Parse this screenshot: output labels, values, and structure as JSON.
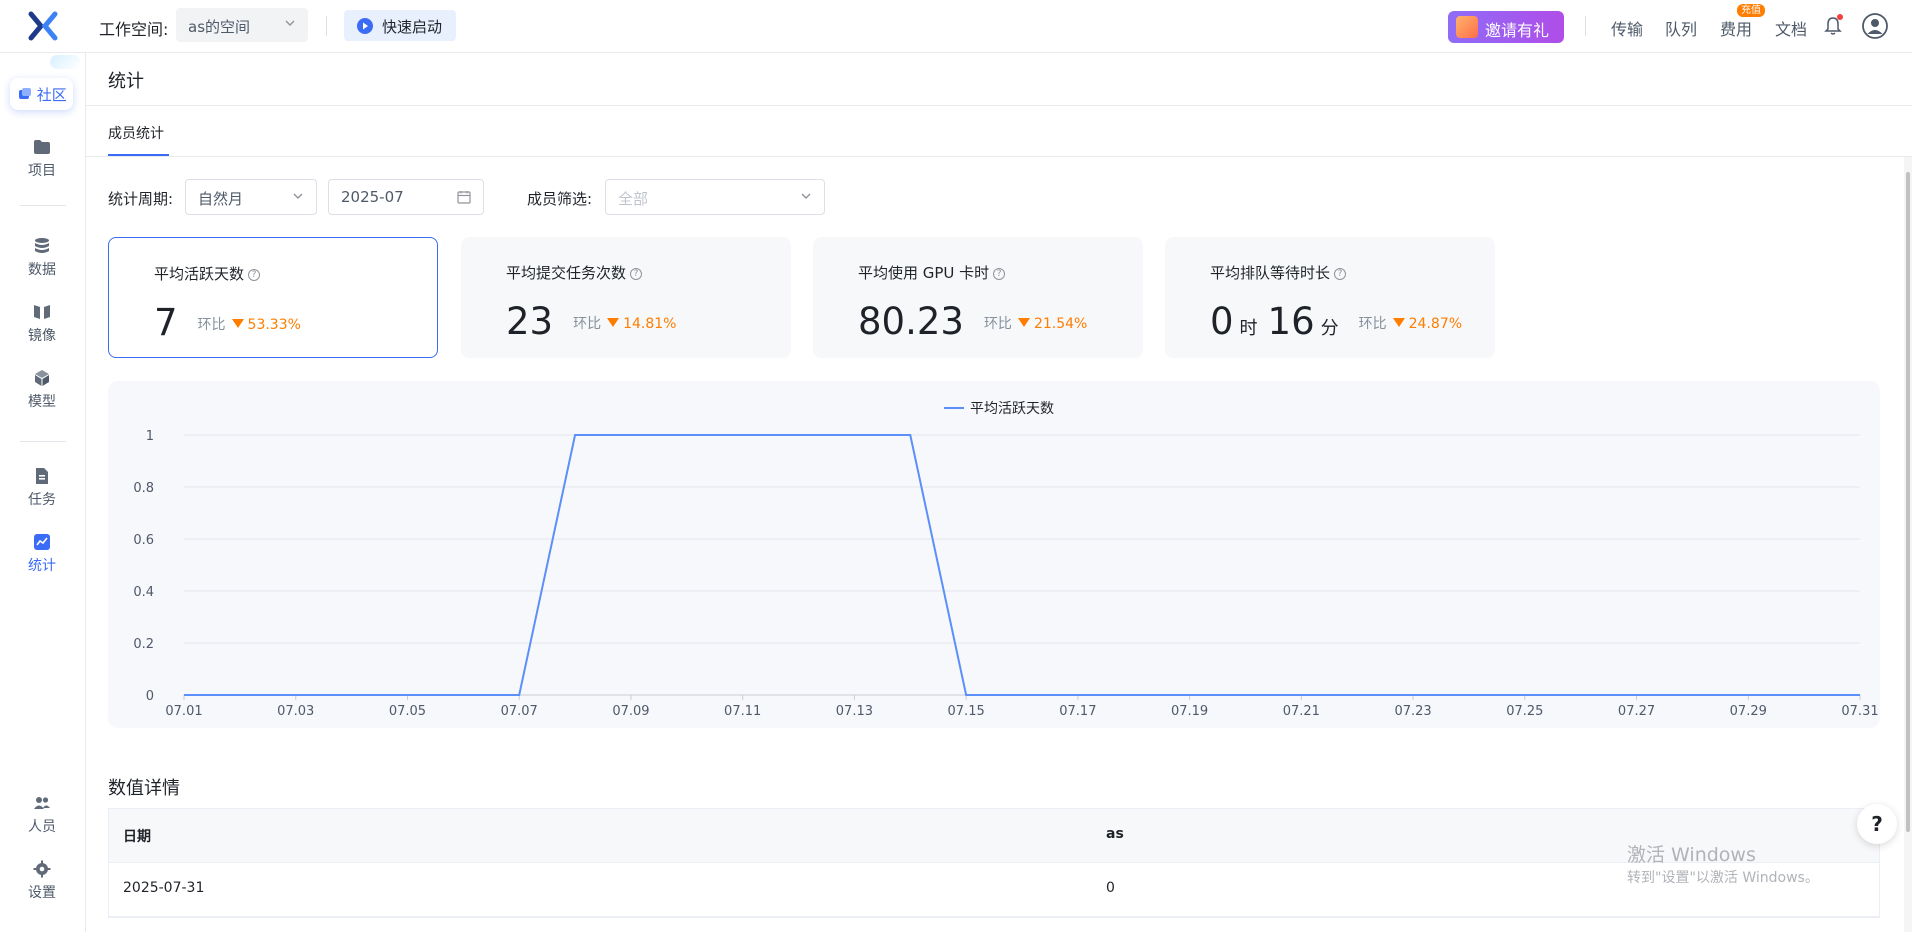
{
  "header": {
    "workspace_label": "工作空间:",
    "workspace_value": "as的空间",
    "quick_start": "快速启动",
    "invite": "邀请有礼",
    "nav": [
      "传输",
      "队列",
      "费用",
      "文档"
    ],
    "recharge_badge": "充值"
  },
  "sidebar": {
    "community": "社区",
    "items": [
      {
        "label": "项目",
        "icon": "folder-icon"
      },
      {
        "label": "数据",
        "icon": "database-icon"
      },
      {
        "label": "镜像",
        "icon": "image-icon"
      },
      {
        "label": "模型",
        "icon": "cube-icon"
      },
      {
        "label": "任务",
        "icon": "task-icon"
      },
      {
        "label": "统计",
        "icon": "stats-icon",
        "active": true
      },
      {
        "label": "人员",
        "icon": "users-icon"
      },
      {
        "label": "设置",
        "icon": "gear-icon"
      }
    ]
  },
  "page": {
    "title": "统计",
    "tab": "成员统计"
  },
  "filters": {
    "period_label": "统计周期:",
    "period_value": "自然月",
    "month_value": "2025-07",
    "member_label": "成员筛选:",
    "member_placeholder": "全部"
  },
  "cards": [
    {
      "label": "平均活跃天数",
      "value": "7",
      "cmp": "环比",
      "pct": "53.33%"
    },
    {
      "label": "平均提交任务次数",
      "value": "23",
      "cmp": "环比",
      "pct": "14.81%"
    },
    {
      "label": "平均使用 GPU 卡时",
      "value": "80.23",
      "cmp": "环比",
      "pct": "21.54%"
    },
    {
      "label": "平均排队等待时长",
      "hours": "0",
      "hour_unit": "时",
      "minutes": "16",
      "minute_unit": "分",
      "cmp": "环比",
      "pct": "24.87%"
    }
  ],
  "chart_data": {
    "type": "line",
    "legend_position": "top-center",
    "ylim": [
      0,
      1
    ],
    "y_ticks": [
      "0",
      "0.2",
      "0.4",
      "0.6",
      "0.8",
      "1"
    ],
    "x_ticks": [
      "07.01",
      "07.03",
      "07.05",
      "07.07",
      "07.09",
      "07.11",
      "07.13",
      "07.15",
      "07.17",
      "07.19",
      "07.21",
      "07.23",
      "07.25",
      "07.27",
      "07.29",
      "07.31"
    ],
    "x": [
      "07.01",
      "07.02",
      "07.03",
      "07.04",
      "07.05",
      "07.06",
      "07.07",
      "07.08",
      "07.09",
      "07.10",
      "07.11",
      "07.12",
      "07.13",
      "07.14",
      "07.15",
      "07.16",
      "07.17",
      "07.18",
      "07.19",
      "07.20",
      "07.21",
      "07.22",
      "07.23",
      "07.24",
      "07.25",
      "07.26",
      "07.27",
      "07.28",
      "07.29",
      "07.30",
      "07.31"
    ],
    "series": [
      {
        "name": "平均活跃天数",
        "color": "#5b8ff9",
        "values": [
          0,
          0,
          0,
          0,
          0,
          0,
          0,
          1,
          1,
          1,
          1,
          1,
          1,
          1,
          0,
          0,
          0,
          0,
          0,
          0,
          0,
          0,
          0,
          0,
          0,
          0,
          0,
          0,
          0,
          0,
          0
        ]
      }
    ]
  },
  "details": {
    "title": "数值详情",
    "columns": [
      "日期",
      "as"
    ],
    "rows": [
      [
        "2025-07-31",
        "0"
      ]
    ]
  },
  "watermark": {
    "line1": "激活 Windows",
    "line2": "转到\"设置\"以激活 Windows。"
  },
  "help_fab": "?"
}
